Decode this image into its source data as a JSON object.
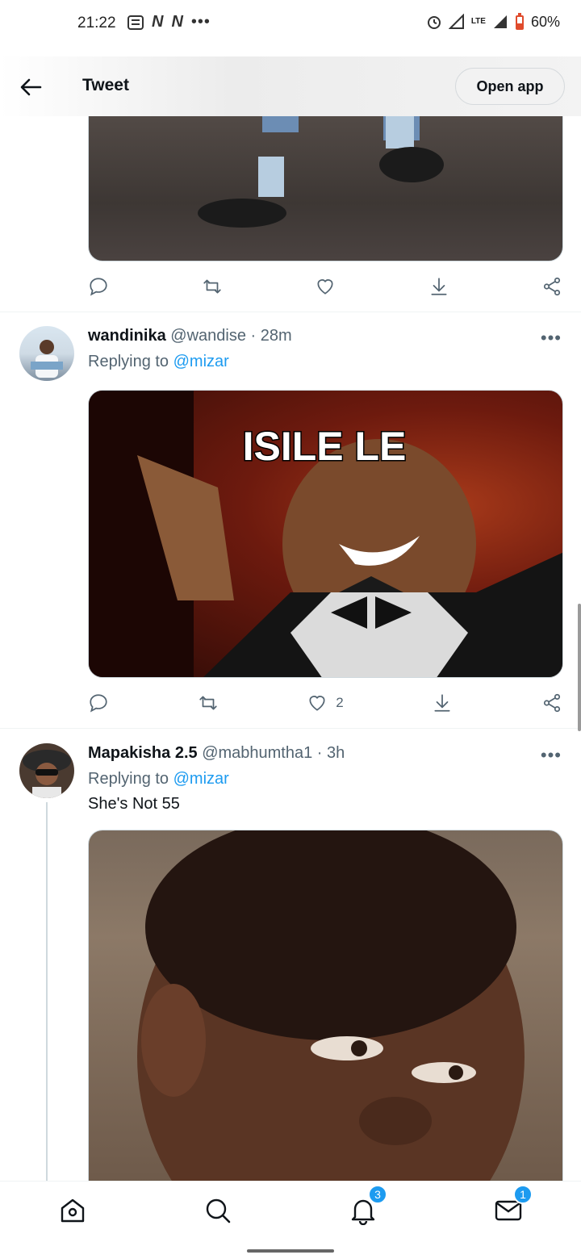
{
  "status_bar": {
    "time": "21:22",
    "battery": "60%",
    "network": "LTE",
    "notification_icons": [
      "news-icon",
      "netflix-icon",
      "netflix-icon",
      "more-dots-icon"
    ]
  },
  "header": {
    "title": "Tweet",
    "open_app_label": "Open app"
  },
  "top_tweet_actions": {
    "reply_count": "",
    "retweet_count": "",
    "like_count": "",
    "colors": {
      "icon": "#536471"
    }
  },
  "tweets": [
    {
      "name": "wandinika",
      "handle": "@wandise",
      "time": "28m",
      "replying_prefix": "Replying to",
      "replying_to": "@mizar",
      "image_caption": "ISILE LE",
      "like_count": "2"
    },
    {
      "name": "Mapakisha 2.5",
      "handle": "@mabhumtha1",
      "time": "3h",
      "replying_prefix": "Replying to",
      "replying_to": "@mizar",
      "text": "She's Not 55"
    }
  ],
  "bottom_nav": {
    "items": [
      {
        "name": "home",
        "icon": "home-icon"
      },
      {
        "name": "search",
        "icon": "search-icon"
      },
      {
        "name": "notifications",
        "icon": "bell-icon",
        "badge": "3"
      },
      {
        "name": "messages",
        "icon": "mail-icon",
        "badge": "1"
      }
    ]
  },
  "colors": {
    "accent": "#1d9bf0",
    "text_primary": "#0f1419",
    "text_secondary": "#536471"
  }
}
